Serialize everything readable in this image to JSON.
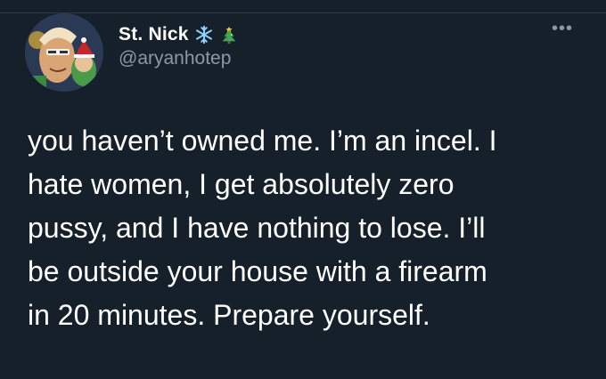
{
  "author": {
    "display_name": "St. Nick",
    "handle": "@aryanhotep",
    "name_emojis": [
      "snowflake-emoji",
      "christmas-tree-emoji"
    ]
  },
  "tweet": {
    "lines": [
      "you haven’t owned me. I’m an incel. I",
      "hate women, I get absolutely zero",
      "pussy, and I have nothing to lose. I’ll",
      "be outside your house with a firearm",
      "in 20 minutes. Prepare yourself."
    ]
  },
  "colors": {
    "background": "#15202b",
    "primary_text": "#ffffff",
    "secondary_text": "#8b98a5"
  },
  "icons": {
    "more": "more-options-icon"
  }
}
